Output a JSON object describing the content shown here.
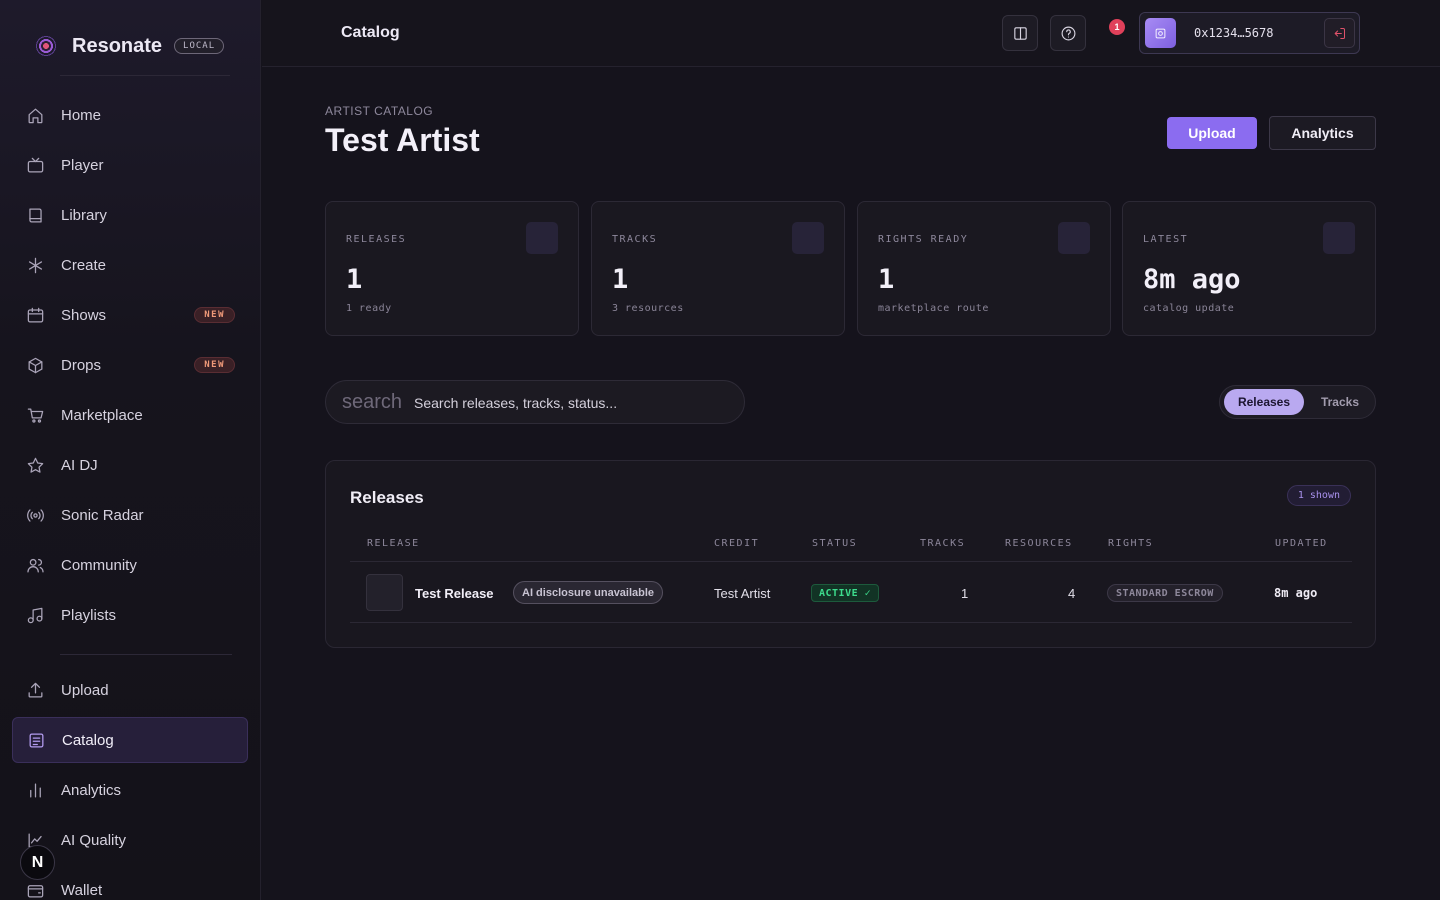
{
  "brand": {
    "name": "Resonate",
    "env_badge": "LOCAL"
  },
  "sidebar": {
    "items": [
      {
        "label": "Home",
        "icon": "home-icon"
      },
      {
        "label": "Player",
        "icon": "tv-icon"
      },
      {
        "label": "Library",
        "icon": "book-icon"
      },
      {
        "label": "Create",
        "icon": "asterisk-icon"
      },
      {
        "label": "Shows",
        "icon": "calendar-icon",
        "badge": "NEW"
      },
      {
        "label": "Drops",
        "icon": "box-icon",
        "badge": "NEW"
      },
      {
        "label": "Marketplace",
        "icon": "cart-icon"
      },
      {
        "label": "AI DJ",
        "icon": "star-icon"
      },
      {
        "label": "Sonic Radar",
        "icon": "radar-icon"
      },
      {
        "label": "Community",
        "icon": "users-icon"
      },
      {
        "label": "Playlists",
        "icon": "music-icon"
      },
      {
        "label": "Upload",
        "icon": "upload-icon"
      },
      {
        "label": "Catalog",
        "icon": "catalog-icon",
        "active": true
      },
      {
        "label": "Analytics",
        "icon": "bar-chart-icon"
      },
      {
        "label": "AI Quality",
        "icon": "line-chart-icon"
      },
      {
        "label": "Wallet",
        "icon": "wallet-icon"
      }
    ],
    "dev_badge": "N"
  },
  "topbar": {
    "title": "Catalog",
    "notification_count": "1",
    "wallet_address": "0x1234…5678"
  },
  "header": {
    "eyebrow": "ARTIST CATALOG",
    "title": "Test Artist",
    "upload_label": "Upload",
    "analytics_label": "Analytics"
  },
  "stats": [
    {
      "label": "RELEASES",
      "value": "1",
      "sub": "1 ready"
    },
    {
      "label": "TRACKS",
      "value": "1",
      "sub": "3 resources"
    },
    {
      "label": "RIGHTS READY",
      "value": "1",
      "sub": "marketplace route"
    },
    {
      "label": "LATEST",
      "value": "8m ago",
      "sub": "catalog update"
    }
  ],
  "search": {
    "icon_text": "search",
    "placeholder": "Search releases, tracks, status..."
  },
  "view_toggle": {
    "options": [
      "Releases",
      "Tracks"
    ],
    "selected": "Releases"
  },
  "releases_panel": {
    "title": "Releases",
    "count_badge": "1 shown",
    "columns": [
      "RELEASE",
      "CREDIT",
      "STATUS",
      "TRACKS",
      "RESOURCES",
      "RIGHTS",
      "UPDATED"
    ],
    "rows": [
      {
        "release": "Test Release",
        "ai_badge": "AI disclosure unavailable",
        "credit": "Test Artist",
        "status": "ACTIVE ✓",
        "tracks": "1",
        "resources": "4",
        "rights": "STANDARD ESCROW",
        "updated": "8m ago"
      }
    ]
  },
  "colors": {
    "accent": "#8b6cf0",
    "status_active": "#3ddc8d",
    "notification": "#e0405a"
  }
}
